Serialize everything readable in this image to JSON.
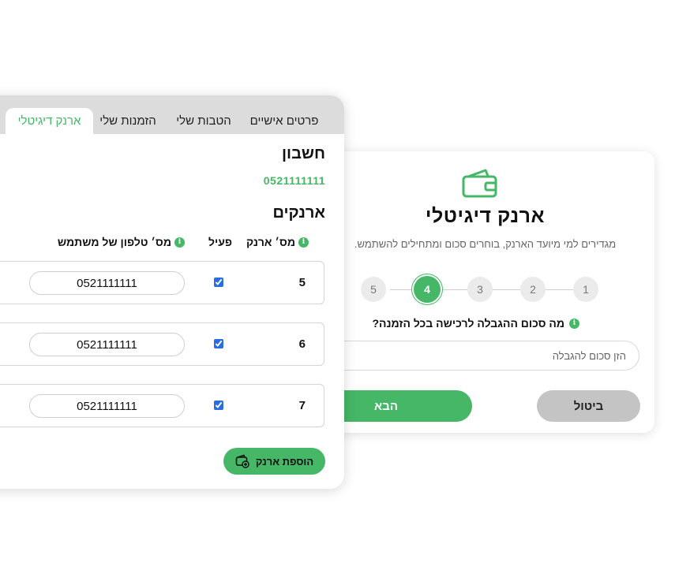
{
  "colors": {
    "accent": "#45b766",
    "muted_button": "#c4c4c4",
    "tab_bar": "#dcdcdc"
  },
  "wizard": {
    "icon": "wallet-icon",
    "title": "ארנק דיגיטלי",
    "subtitle": "מגדירים למי מיועד הארנק, בוחרים סכום ומתחילים להשתמש.",
    "steps": [
      "1",
      "2",
      "3",
      "4",
      "5"
    ],
    "active_step": "4",
    "question": "מה סכום ההגבלה לרכישה בכל הזמנה?",
    "limit_placeholder": "הזן סכום להגבלה",
    "cancel_label": "ביטול",
    "next_label": "הבא"
  },
  "wallets_panel": {
    "tabs": [
      {
        "label": "פרטים אישיים"
      },
      {
        "label": "הטבות שלי"
      },
      {
        "label": "הזמנות שלי"
      },
      {
        "label": "ארנק דיגיטלי"
      }
    ],
    "active_tab": "ארנק דיגיטלי",
    "account_title": "חשבון",
    "account_number": "0521111111",
    "wallets_title": "ארנקים",
    "columns": {
      "wallet_no": "מס׳ ארנק",
      "active": "פעיל",
      "user_phone": "מס׳ טלפון של משתמש"
    },
    "rows": [
      {
        "wallet_no": "5",
        "active": true,
        "phone": "0521111111"
      },
      {
        "wallet_no": "6",
        "active": true,
        "phone": "0521111111"
      },
      {
        "wallet_no": "7",
        "active": true,
        "phone": "0521111111"
      }
    ],
    "add_wallet_label": "הוספת ארנק",
    "add_wallet_icon": "wallet-plus-icon"
  }
}
